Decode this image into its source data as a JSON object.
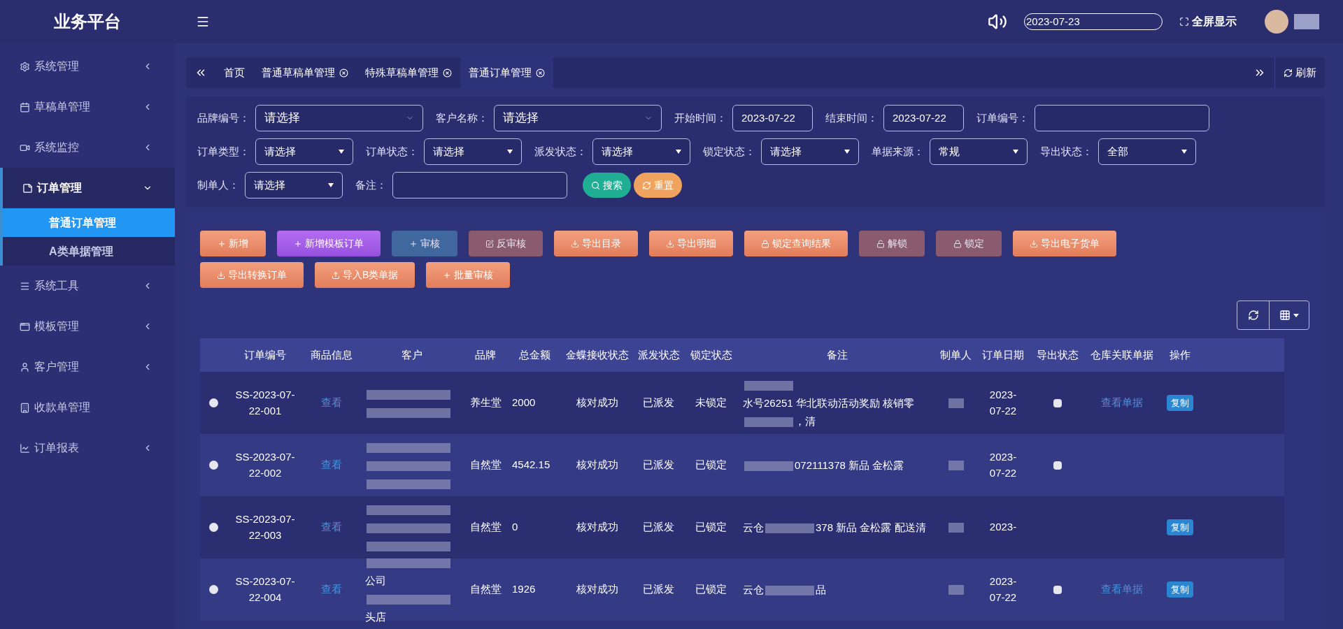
{
  "brand": "业务平台",
  "header": {
    "date": "2023-07-23",
    "fullscreen": "全屏显示"
  },
  "sidebar": {
    "items": [
      {
        "label": "系统管理",
        "expanded": false
      },
      {
        "label": "草稿单管理",
        "expanded": false
      },
      {
        "label": "系统监控",
        "expanded": false
      },
      {
        "label": "订单管理",
        "expanded": true,
        "children": [
          {
            "label": "普通订单管理",
            "selected": true
          },
          {
            "label": "A类单据管理",
            "selected": false
          }
        ]
      },
      {
        "label": "系统工具",
        "expanded": false
      },
      {
        "label": "模板管理",
        "expanded": false
      },
      {
        "label": "客户管理",
        "expanded": false
      },
      {
        "label": "收款单管理",
        "expanded": false,
        "has_arrow": false
      },
      {
        "label": "订单报表",
        "expanded": false
      }
    ]
  },
  "tabs": [
    {
      "label": "首页",
      "closable": false,
      "selected": false
    },
    {
      "label": "普通草稿单管理",
      "closable": true,
      "selected": false
    },
    {
      "label": "特殊草稿单管理",
      "closable": true,
      "selected": false
    },
    {
      "label": "普通订单管理",
      "closable": true,
      "selected": true
    }
  ],
  "refresh": "刷新",
  "filters": [
    [
      {
        "label": "品牌编号：",
        "kind": "combo",
        "value": "请选择"
      },
      {
        "label": "客户名称：",
        "kind": "combo",
        "value": "请选择"
      },
      {
        "label": "开始时间：",
        "kind": "date",
        "value": "2023-07-22"
      },
      {
        "label": "结束时间：",
        "kind": "date",
        "value": "2023-07-22"
      },
      {
        "label": "订单编号：",
        "kind": "text"
      }
    ],
    [
      {
        "label": "订单类型：",
        "kind": "select",
        "value": "请选择"
      },
      {
        "label": "订单状态：",
        "kind": "select",
        "value": "请选择"
      },
      {
        "label": "派发状态：",
        "kind": "select",
        "value": "请选择"
      },
      {
        "label": "锁定状态：",
        "kind": "select",
        "value": "请选择"
      },
      {
        "label": "单据来源：",
        "kind": "select",
        "value": "常规"
      },
      {
        "label": "导出状态：",
        "kind": "select",
        "value": "全部"
      }
    ],
    [
      {
        "label": "制单人：",
        "kind": "select",
        "value": "请选择"
      },
      {
        "label": "备注：",
        "kind": "text"
      }
    ]
  ],
  "search_button": "搜索",
  "reset_button": "重置",
  "actions": [
    {
      "label": "新增",
      "kind": "orange",
      "disabled": false
    },
    {
      "label": "新增模板订单",
      "kind": "purple",
      "disabled": false
    },
    {
      "label": "审核",
      "kind": "blue",
      "disabled": true
    },
    {
      "label": "反审核",
      "kind": "orange",
      "disabled": true
    },
    {
      "label": "导出目录",
      "kind": "orange",
      "disabled": false
    },
    {
      "label": "导出明细",
      "kind": "orange",
      "disabled": false
    },
    {
      "label": "锁定查询结果",
      "kind": "orange",
      "disabled": false
    },
    {
      "label": "解锁",
      "kind": "orange",
      "disabled": true
    },
    {
      "label": "锁定",
      "kind": "orange",
      "disabled": true
    },
    {
      "label": "导出电子货单",
      "kind": "orange",
      "disabled": false
    },
    {
      "label": "导出转换订单",
      "kind": "orange",
      "disabled": false
    },
    {
      "label": "导入B类单据",
      "kind": "orange",
      "disabled": false
    },
    {
      "label": "批量审核",
      "kind": "orange",
      "disabled": false
    }
  ],
  "table": {
    "columns": [
      "订单编号",
      "商品信息",
      "客户",
      "品牌",
      "总金额",
      "金蝶接收状态",
      "派发状态",
      "锁定状态",
      "备注",
      "制单人",
      "订单日期",
      "导出状态",
      "仓库关联单据",
      "操作"
    ],
    "rows": [
      {
        "selected": false,
        "order_no": "SS-2023-07-22-001",
        "goods": "查看",
        "customer": [
          {
            "kind": "blur"
          },
          {
            "kind": "blur"
          }
        ],
        "brand": "养生堂",
        "total": "2000",
        "kingdee": "核对成功",
        "dispatch": "已派发",
        "lock": "未锁定",
        "remark": [
          {
            "kind": "blur"
          },
          {
            "kind": "text",
            "text": "水号26251 华北联动活动奖励 核销零"
          },
          {
            "kind": "blur"
          },
          {
            "kind": "text",
            "text": "，清"
          }
        ],
        "date": "2023-07-22",
        "exported": false,
        "link": "查看单据",
        "op": "复制"
      },
      {
        "selected": false,
        "order_no": "SS-2023-07-22-002",
        "goods": "查看",
        "customer": [
          {
            "kind": "blur"
          },
          {
            "kind": "blur"
          },
          {
            "kind": "blur"
          }
        ],
        "brand": "自然堂",
        "total": "4542.15",
        "kingdee": "核对成功",
        "dispatch": "已派发",
        "lock": "已锁定",
        "remark": [
          {
            "kind": "blur"
          },
          {
            "kind": "text",
            "text": "072111378 新品 金松露"
          }
        ],
        "date": "2023-07-22",
        "exported": false
      },
      {
        "selected": false,
        "order_no": "SS-2023-07-22-003",
        "goods": "查看",
        "customer": [
          {
            "kind": "blur"
          },
          {
            "kind": "blur"
          },
          {
            "kind": "blur"
          }
        ],
        "brand": "自然堂",
        "total": "0",
        "kingdee": "核对成功",
        "dispatch": "已派发",
        "lock": "已锁定",
        "remark": [
          {
            "kind": "text",
            "text": "云仓"
          },
          {
            "kind": "blur"
          },
          {
            "kind": "text",
            "text": "378 新品 金松露 配送清"
          }
        ],
        "date": "2023-",
        "op": "复制"
      },
      {
        "selected": false,
        "order_no": "SS-2023-07-22-004",
        "goods": "查看",
        "customer": [
          {
            "kind": "blur"
          },
          {
            "kind": "text",
            "text": "公司"
          },
          {
            "kind": "blur"
          },
          {
            "kind": "text",
            "text": "头店"
          }
        ],
        "brand": "自然堂",
        "total": "1926",
        "kingdee": "核对成功",
        "dispatch": "已派发",
        "lock": "已锁定",
        "remark": [
          {
            "kind": "text",
            "text": "云仓"
          },
          {
            "kind": "blur"
          },
          {
            "kind": "text",
            "text": "品"
          }
        ],
        "date": "2023-07-22",
        "exported": false,
        "link": "查看单据",
        "op": "复制"
      }
    ]
  }
}
